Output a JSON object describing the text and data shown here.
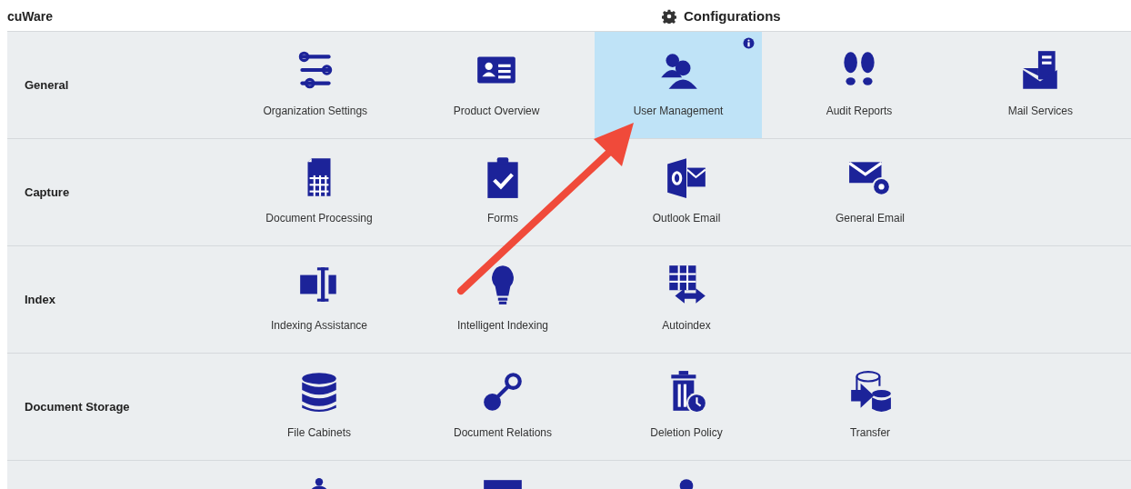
{
  "app": {
    "name": "cuWare"
  },
  "header": {
    "title": "Configurations"
  },
  "sections": [
    {
      "label": "General",
      "tiles": [
        {
          "kind": "full",
          "label": "Organization Settings",
          "selected": false,
          "info": false
        },
        {
          "kind": "full",
          "label": "Product Overview",
          "selected": false,
          "info": false
        },
        {
          "kind": "full",
          "label": "User Management",
          "selected": true,
          "info": true
        },
        {
          "kind": "full",
          "label": "Audit Reports",
          "selected": false,
          "info": false
        },
        {
          "kind": "full",
          "label": "Mail Services",
          "selected": false,
          "info": false
        }
      ]
    },
    {
      "label": "Capture",
      "tiles": [
        {
          "kind": "full",
          "label": "Document Processing",
          "selected": false,
          "info": false
        },
        {
          "kind": "full",
          "label": "Forms",
          "selected": false,
          "info": false
        },
        {
          "kind": "full",
          "label": "Outlook Email",
          "selected": false,
          "info": false
        },
        {
          "kind": "full",
          "label": "General Email",
          "selected": false,
          "info": false
        }
      ]
    },
    {
      "label": "Index",
      "tiles": [
        {
          "kind": "full",
          "label": "Indexing Assistance",
          "selected": false,
          "info": false
        },
        {
          "kind": "full",
          "label": "Intelligent Indexing",
          "selected": false,
          "info": false
        },
        {
          "kind": "full",
          "label": "Autoindex",
          "selected": false,
          "info": false
        }
      ]
    },
    {
      "label": "Document Storage",
      "tiles": [
        {
          "kind": "full",
          "label": "File Cabinets",
          "selected": false,
          "info": false
        },
        {
          "kind": "full",
          "label": "Document Relations",
          "selected": false,
          "info": false
        },
        {
          "kind": "full",
          "label": "Deletion Policy",
          "selected": false,
          "info": false
        },
        {
          "kind": "full",
          "label": "Transfer",
          "selected": false,
          "info": false
        }
      ]
    },
    {
      "tiles": [
        {
          "kind": "cut"
        },
        {
          "kind": "cut"
        },
        {
          "kind": "cut"
        }
      ]
    }
  ],
  "annotation": {
    "kind": "arrow"
  }
}
